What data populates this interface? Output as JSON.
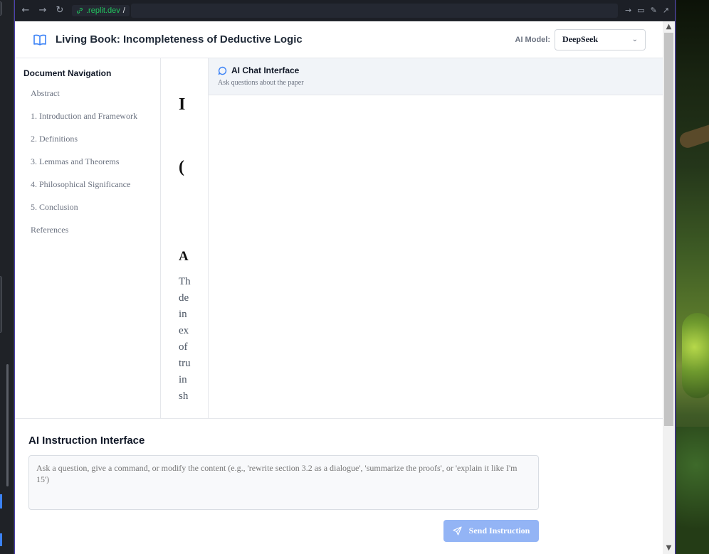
{
  "browser": {
    "url_host": ".replit.dev",
    "url_path": "/"
  },
  "header": {
    "title": "Living Book: Incompleteness of Deductive Logic",
    "model_label": "AI Model:",
    "model_value": "DeepSeek"
  },
  "sidebar": {
    "heading": "Document Navigation",
    "items": [
      {
        "label": "Abstract"
      },
      {
        "label": "1. Introduction and Framework"
      },
      {
        "label": "2. Definitions"
      },
      {
        "label": "3. Lemmas and Theorems"
      },
      {
        "label": "4. Philosophical Significance"
      },
      {
        "label": "5. Conclusion"
      },
      {
        "label": "References"
      }
    ]
  },
  "document": {
    "title_fragment": "I",
    "subtitle_fragment": "(",
    "section_fragment": "A",
    "body_fragments": [
      "Th",
      "de",
      "in",
      "ex",
      "of",
      "tru",
      "in",
      "sh"
    ]
  },
  "chat": {
    "title": "AI Chat Interface",
    "subtitle": "Ask questions about the paper"
  },
  "instruction": {
    "title": "AI Instruction Interface",
    "placeholder": "Ask a question, give a command, or modify the content (e.g., 'rewrite section 3.2 as a dialogue', 'summarize the proofs', or 'explain it like I'm 15')",
    "send_label": "Send Instruction"
  },
  "colors": {
    "accent": "#3b82f6",
    "send_disabled": "#93b4f5",
    "url_green": "#22c55e"
  }
}
